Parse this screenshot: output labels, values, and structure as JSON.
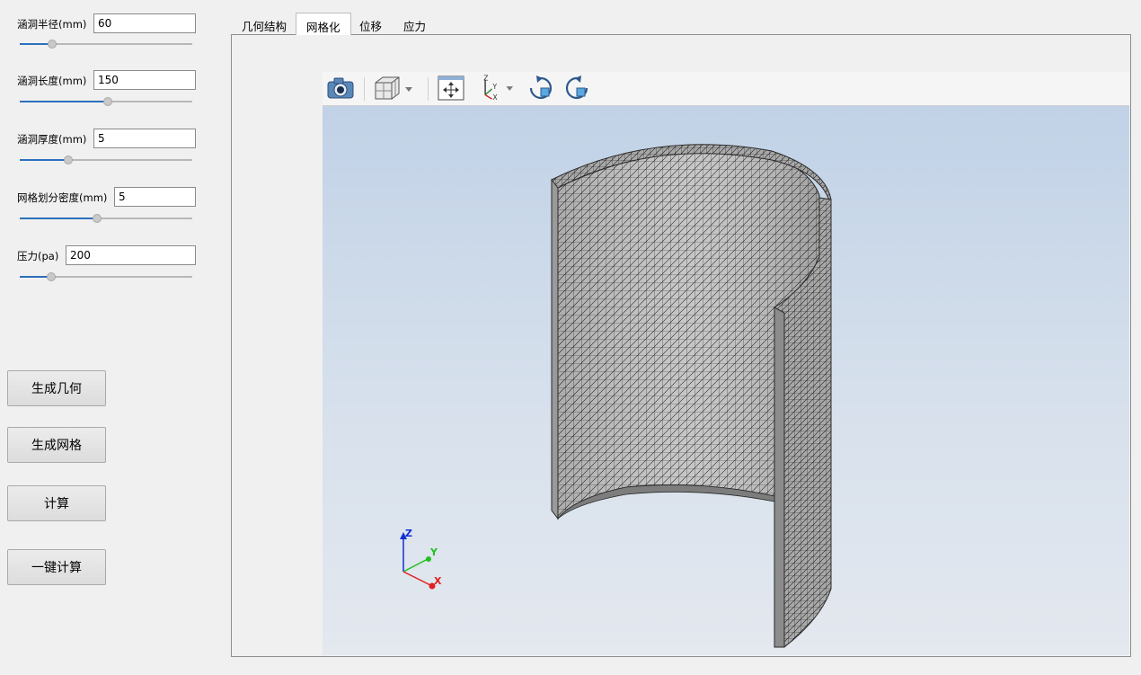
{
  "params": [
    {
      "label": "涵洞半径(mm)",
      "value": "60",
      "slider_fraction": 0.19
    },
    {
      "label": "涵洞长度(mm)",
      "value": "150",
      "slider_fraction": 0.51
    },
    {
      "label": "涵洞厚度(mm)",
      "value": "5",
      "slider_fraction": 0.28
    },
    {
      "label": "网格划分密度(mm)",
      "value": "5",
      "slider_fraction": 0.45
    },
    {
      "label": "压力(pa)",
      "value": "200",
      "slider_fraction": 0.18
    }
  ],
  "buttons": {
    "generate_geometry": "生成几何",
    "generate_mesh": "生成网格",
    "compute": "计算",
    "one_click_compute": "一键计算"
  },
  "tabs": [
    {
      "label": "几何结构",
      "active": false
    },
    {
      "label": "网格化",
      "active": true
    },
    {
      "label": "位移",
      "active": false
    },
    {
      "label": "应力",
      "active": false
    }
  ],
  "viewer": {
    "toolbar_icons": [
      "camera-icon",
      "view-cube-icon",
      "fit-view-icon",
      "axis-orient-icon",
      "rotate-cw-icon",
      "rotate-ccw-icon"
    ],
    "axes": {
      "z": "Z",
      "y": "Y",
      "x": "X"
    },
    "colors": {
      "mesh_face": "#c4c4c4",
      "mesh_line": "#1e1e1e",
      "axis_x": "#e02020",
      "axis_y": "#20c020",
      "axis_z": "#1030d0"
    }
  }
}
